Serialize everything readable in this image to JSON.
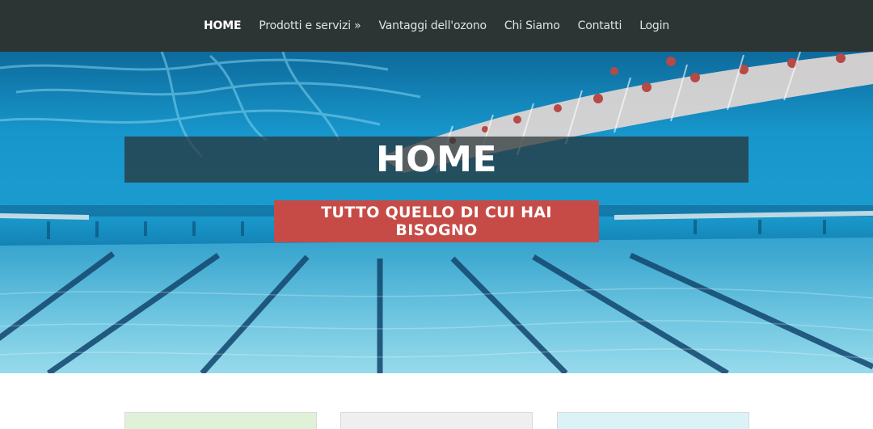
{
  "nav": {
    "items": [
      {
        "label": "HOME",
        "active": true
      },
      {
        "label": "Prodotti e servizi »",
        "active": false
      },
      {
        "label": "Vantaggi dell'ozono",
        "active": false
      },
      {
        "label": "Chi Siamo",
        "active": false
      },
      {
        "label": "Contatti",
        "active": false
      },
      {
        "label": "Login",
        "active": false
      }
    ]
  },
  "hero": {
    "title": "HOME",
    "cta_label": "TUTTO QUELLO DI CUI HAI BISOGNO",
    "image": "swimming-pool-underwater-photo"
  },
  "colors": {
    "nav_bg": "#2c3534",
    "cta_bg": "#c64b47",
    "title_band_bg": "rgba(40,50,52,0.72)"
  }
}
